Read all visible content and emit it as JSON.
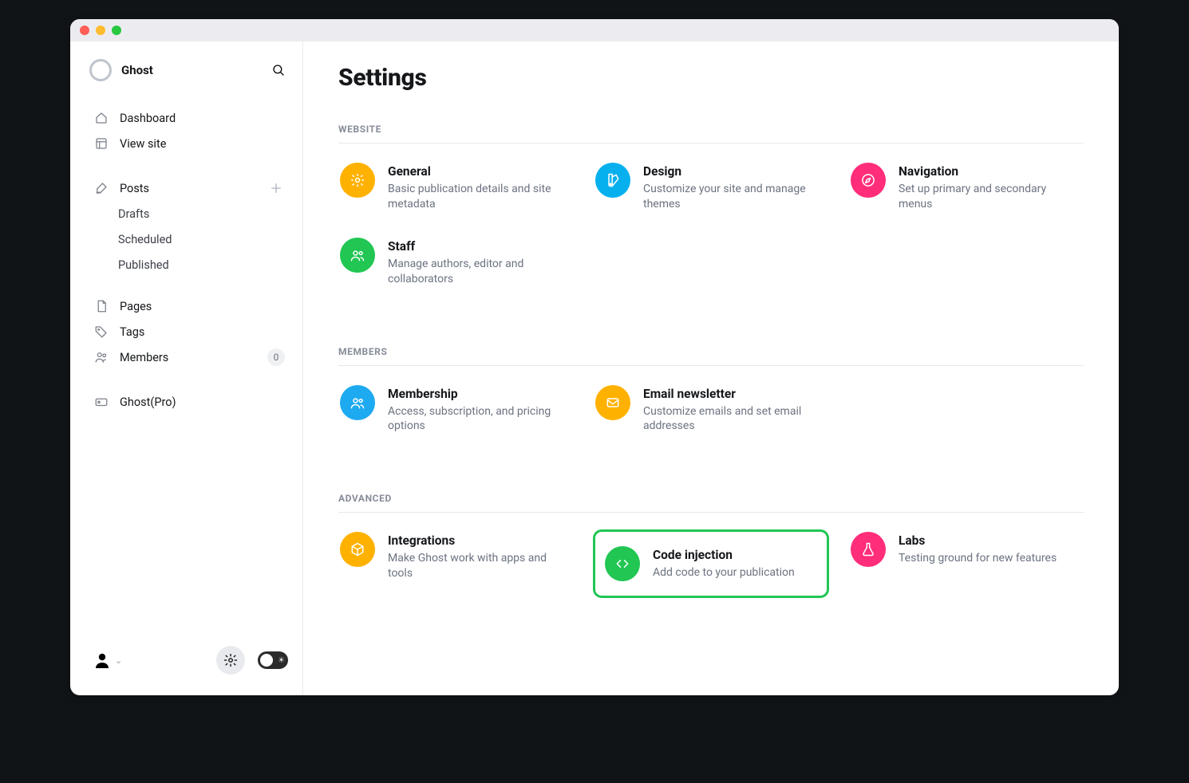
{
  "brand": "Ghost",
  "sidebar": {
    "dashboard": "Dashboard",
    "view_site": "View site",
    "posts": "Posts",
    "drafts": "Drafts",
    "scheduled": "Scheduled",
    "published": "Published",
    "pages": "Pages",
    "tags": "Tags",
    "members": "Members",
    "members_count": "0",
    "ghost_pro": "Ghost(Pro)"
  },
  "page_title": "Settings",
  "sections": {
    "website": {
      "label": "WEBSITE",
      "general": {
        "title": "General",
        "desc": "Basic publication details and site metadata",
        "color": "#ffb100"
      },
      "design": {
        "title": "Design",
        "desc": "Customize your site and manage themes",
        "color": "#06b0ef"
      },
      "navigation": {
        "title": "Navigation",
        "desc": "Set up primary and secondary menus",
        "color": "#ff2d7a"
      },
      "staff": {
        "title": "Staff",
        "desc": "Manage authors, editor and collaborators",
        "color": "#21c653"
      }
    },
    "members": {
      "label": "MEMBERS",
      "membership": {
        "title": "Membership",
        "desc": "Access, subscription, and pricing options",
        "color": "#1eaaf0"
      },
      "email": {
        "title": "Email newsletter",
        "desc": "Customize emails and set email addresses",
        "color": "#ffb100"
      }
    },
    "advanced": {
      "label": "ADVANCED",
      "integrations": {
        "title": "Integrations",
        "desc": "Make Ghost work with apps and tools",
        "color": "#ffb100"
      },
      "code_injection": {
        "title": "Code injection",
        "desc": "Add code to your publication",
        "color": "#21c653"
      },
      "labs": {
        "title": "Labs",
        "desc": "Testing ground for new features",
        "color": "#ff2d7a"
      }
    }
  }
}
